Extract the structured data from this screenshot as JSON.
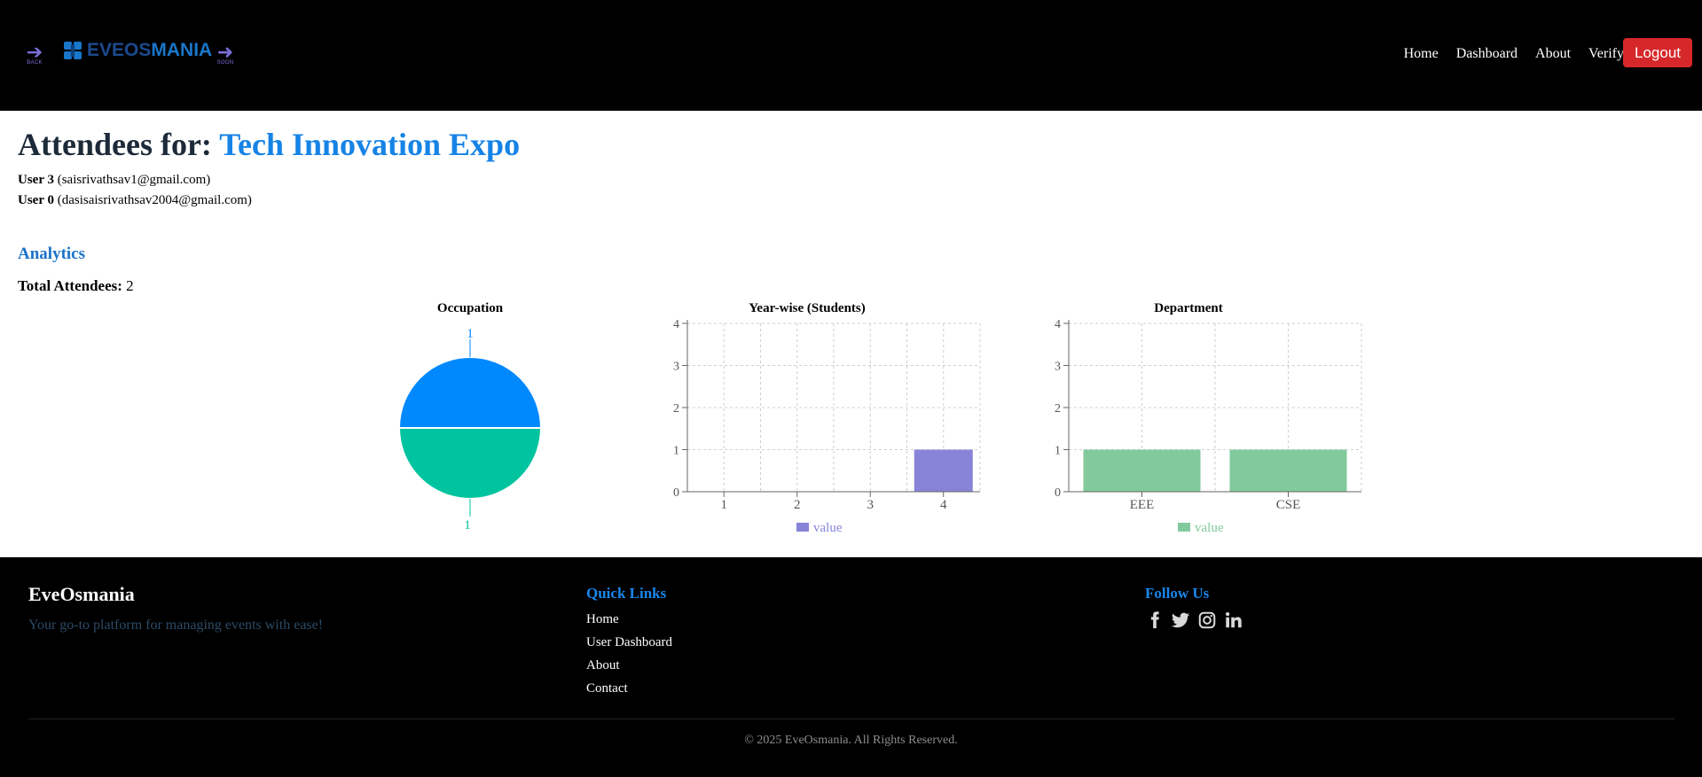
{
  "nav": {
    "back_label": "BACK",
    "soon_label": "SOON",
    "logo_part1": "EVEOS",
    "logo_part2": "MANIA",
    "links": [
      "Home",
      "Dashboard",
      "About",
      "Verify"
    ],
    "logout_label": "Logout",
    "logout_color": "#d6282b"
  },
  "page": {
    "title_prefix": "Attendees for:",
    "event_name": "Tech Innovation Expo",
    "attendees": [
      {
        "name": "User 3",
        "email": "(saisrivathsav1@gmail.com)"
      },
      {
        "name": "User 0",
        "email": "(dasisaisrivathsav2004@gmail.com)"
      }
    ],
    "analytics_heading": "Analytics",
    "total_label": "Total Attendees:",
    "total_value": "2"
  },
  "chart_data": [
    {
      "type": "pie",
      "title": "Occupation",
      "slices": [
        {
          "value": 1,
          "label": "1",
          "color": "#0088fe"
        },
        {
          "value": 1,
          "label": "1",
          "color": "#00c49f"
        }
      ]
    },
    {
      "type": "bar",
      "title": "Year-wise (Students)",
      "categories": [
        "1",
        "2",
        "3",
        "4"
      ],
      "series": [
        {
          "name": "value",
          "values": [
            0,
            0,
            0,
            1
          ],
          "color": "#8884d8"
        }
      ],
      "ylim": [
        0,
        4
      ],
      "yticks": [
        "0",
        "1",
        "2",
        "3",
        "4"
      ],
      "grid": true,
      "legend": "bottom"
    },
    {
      "type": "bar",
      "title": "Department",
      "categories": [
        "EEE",
        "CSE"
      ],
      "series": [
        {
          "name": "value",
          "values": [
            1,
            1
          ],
          "color": "#82ca9d"
        }
      ],
      "ylim": [
        0,
        4
      ],
      "yticks": [
        "0",
        "1",
        "2",
        "3",
        "4"
      ],
      "grid": true,
      "legend": "bottom"
    }
  ],
  "footer": {
    "brand": "EveOsmania",
    "tagline": "Your go-to platform for managing events with ease!",
    "quick_links_heading": "Quick Links",
    "quick_links": [
      "Home",
      "User Dashboard",
      "About",
      "Contact"
    ],
    "follow_heading": "Follow Us",
    "social_icons": [
      "facebook-icon",
      "twitter-icon",
      "instagram-icon",
      "linkedin-icon"
    ],
    "copyright": "© 2025 EveOsmania. All Rights Reserved."
  }
}
